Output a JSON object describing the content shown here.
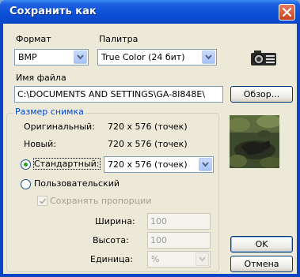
{
  "window": {
    "title": "Сохранить как"
  },
  "format": {
    "label": "Формат",
    "value": "BMP"
  },
  "palette": {
    "label": "Палитра",
    "value": "True Color (24 бит)"
  },
  "icons": {
    "camera": "camera-icon",
    "close": "close-icon",
    "dropdown": "chevron-down-icon"
  },
  "filename": {
    "label": "Имя файла",
    "value": "C:\\DOCUMENTS AND SETTINGS\\GA-8I848E\\",
    "browse_label": "Обзор..."
  },
  "size_group": {
    "title": "Размер снимка",
    "original_label": "Оригинальный:",
    "original_value": "720 x 576 (точек)",
    "new_label": "Новый:",
    "new_value": "720 x 576 (точек)",
    "standard_label": "Стандартный:",
    "standard_value": "720 x 576 (точек)",
    "custom_label": "Пользовательский",
    "keep_ratio_label": "Сохранять пропорции",
    "width_label": "Ширина:",
    "width_value": "100",
    "height_label": "Высота:",
    "height_value": "100",
    "unit_label": "Единица:",
    "unit_value": "%"
  },
  "buttons": {
    "ok": "OK",
    "cancel": "Отмена"
  },
  "colors": {
    "title_bar": "#0a45c8",
    "dialog_bg": "#ece9d8",
    "group_title": "#0046d5"
  }
}
